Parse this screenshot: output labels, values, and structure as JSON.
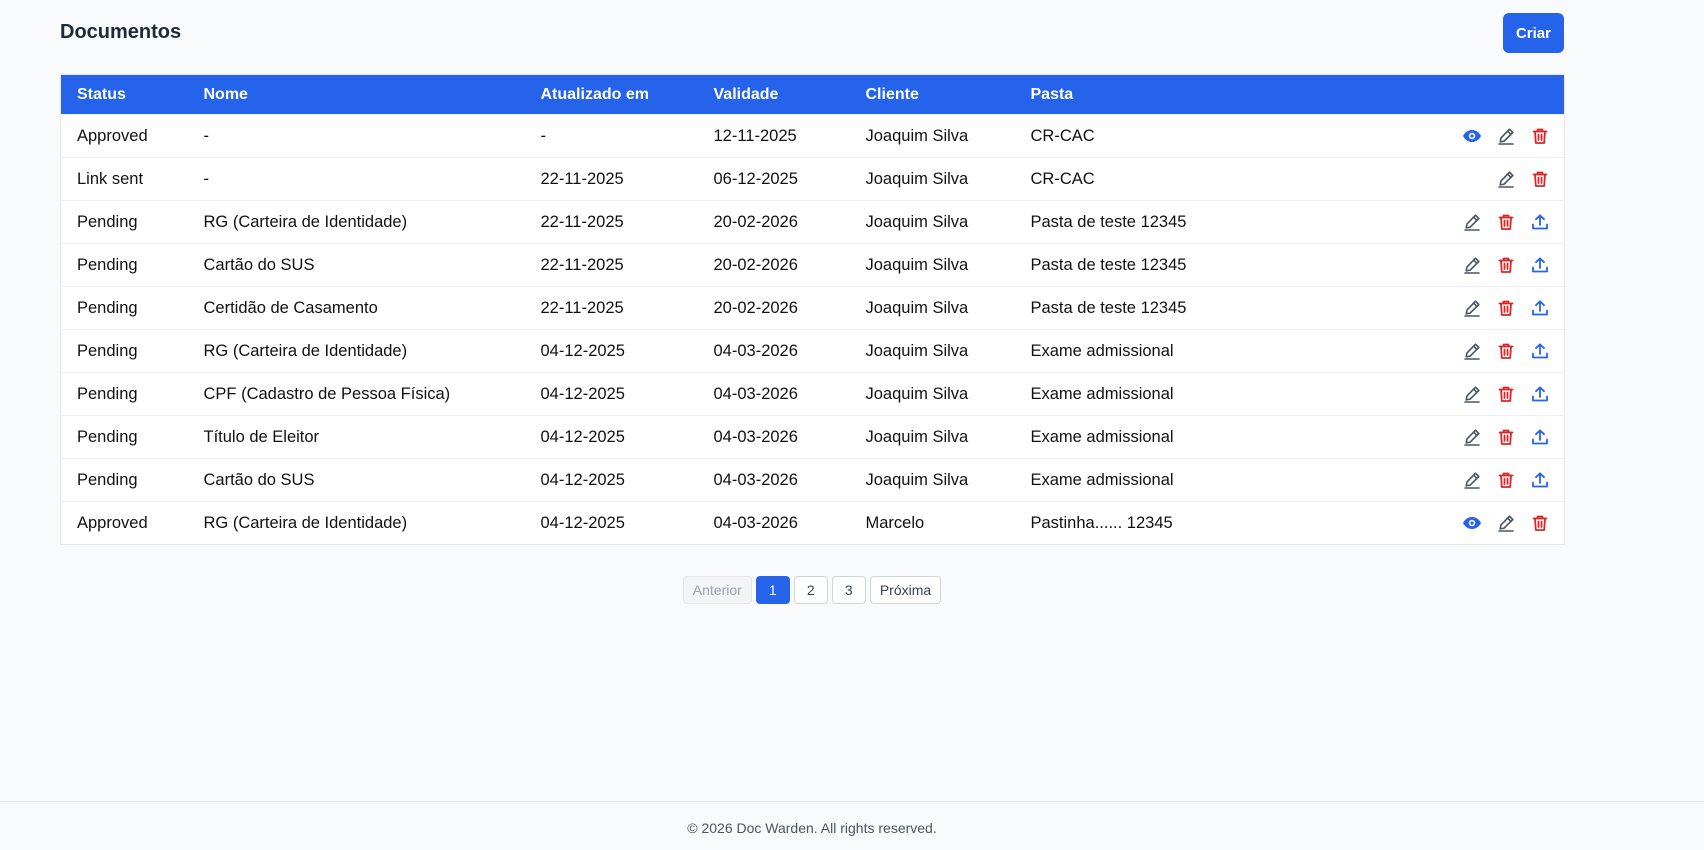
{
  "header": {
    "title": "Documentos",
    "create_label": "Criar"
  },
  "table": {
    "columns": [
      "Status",
      "Nome",
      "Atualizado em",
      "Validade",
      "Cliente",
      "Pasta"
    ],
    "rows": [
      {
        "status": "Approved",
        "nome": "-",
        "atualizado": "-",
        "validade": "12-11-2025",
        "cliente": "Joaquim Silva",
        "pasta": "CR-CAC",
        "actions": [
          "view-icon",
          "edit-icon",
          "delete-icon"
        ]
      },
      {
        "status": "Link sent",
        "nome": "-",
        "atualizado": "22-11-2025",
        "validade": "06-12-2025",
        "cliente": "Joaquim Silva",
        "pasta": "CR-CAC",
        "actions": [
          "edit-icon",
          "delete-icon"
        ]
      },
      {
        "status": "Pending",
        "nome": "RG (Carteira de Identidade)",
        "atualizado": "22-11-2025",
        "validade": "20-02-2026",
        "cliente": "Joaquim Silva",
        "pasta": "Pasta de teste 12345",
        "actions": [
          "edit-icon",
          "delete-icon",
          "upload-icon"
        ]
      },
      {
        "status": "Pending",
        "nome": "Cartão do SUS",
        "atualizado": "22-11-2025",
        "validade": "20-02-2026",
        "cliente": "Joaquim Silva",
        "pasta": "Pasta de teste 12345",
        "actions": [
          "edit-icon",
          "delete-icon",
          "upload-icon"
        ]
      },
      {
        "status": "Pending",
        "nome": "Certidão de Casamento",
        "atualizado": "22-11-2025",
        "validade": "20-02-2026",
        "cliente": "Joaquim Silva",
        "pasta": "Pasta de teste 12345",
        "actions": [
          "edit-icon",
          "delete-icon",
          "upload-icon"
        ]
      },
      {
        "status": "Pending",
        "nome": "RG (Carteira de Identidade)",
        "atualizado": "04-12-2025",
        "validade": "04-03-2026",
        "cliente": "Joaquim Silva",
        "pasta": "Exame admissional",
        "actions": [
          "edit-icon",
          "delete-icon",
          "upload-icon"
        ]
      },
      {
        "status": "Pending",
        "nome": "CPF (Cadastro de Pessoa Física)",
        "atualizado": "04-12-2025",
        "validade": "04-03-2026",
        "cliente": "Joaquim Silva",
        "pasta": "Exame admissional",
        "actions": [
          "edit-icon",
          "delete-icon",
          "upload-icon"
        ]
      },
      {
        "status": "Pending",
        "nome": "Título de Eleitor",
        "atualizado": "04-12-2025",
        "validade": "04-03-2026",
        "cliente": "Joaquim Silva",
        "pasta": "Exame admissional",
        "actions": [
          "edit-icon",
          "delete-icon",
          "upload-icon"
        ]
      },
      {
        "status": "Pending",
        "nome": "Cartão do SUS",
        "atualizado": "04-12-2025",
        "validade": "04-03-2026",
        "cliente": "Joaquim Silva",
        "pasta": "Exame admissional",
        "actions": [
          "edit-icon",
          "delete-icon",
          "upload-icon"
        ]
      },
      {
        "status": "Approved",
        "nome": "RG (Carteira de Identidade)",
        "atualizado": "04-12-2025",
        "validade": "04-03-2026",
        "cliente": "Marcelo",
        "pasta": "Pastinha...... 12345",
        "actions": [
          "view-icon",
          "edit-icon",
          "delete-icon"
        ]
      }
    ]
  },
  "pagination": {
    "prev_label": "Anterior",
    "pages": [
      "1",
      "2",
      "3"
    ],
    "current": "1",
    "next_label": "Próxima"
  },
  "footer": {
    "text": "© 2026 Doc Warden. All rights reserved."
  },
  "colors": {
    "primary": "#2563eb",
    "danger": "#dc2626",
    "edit_icon": "#4b5563"
  }
}
